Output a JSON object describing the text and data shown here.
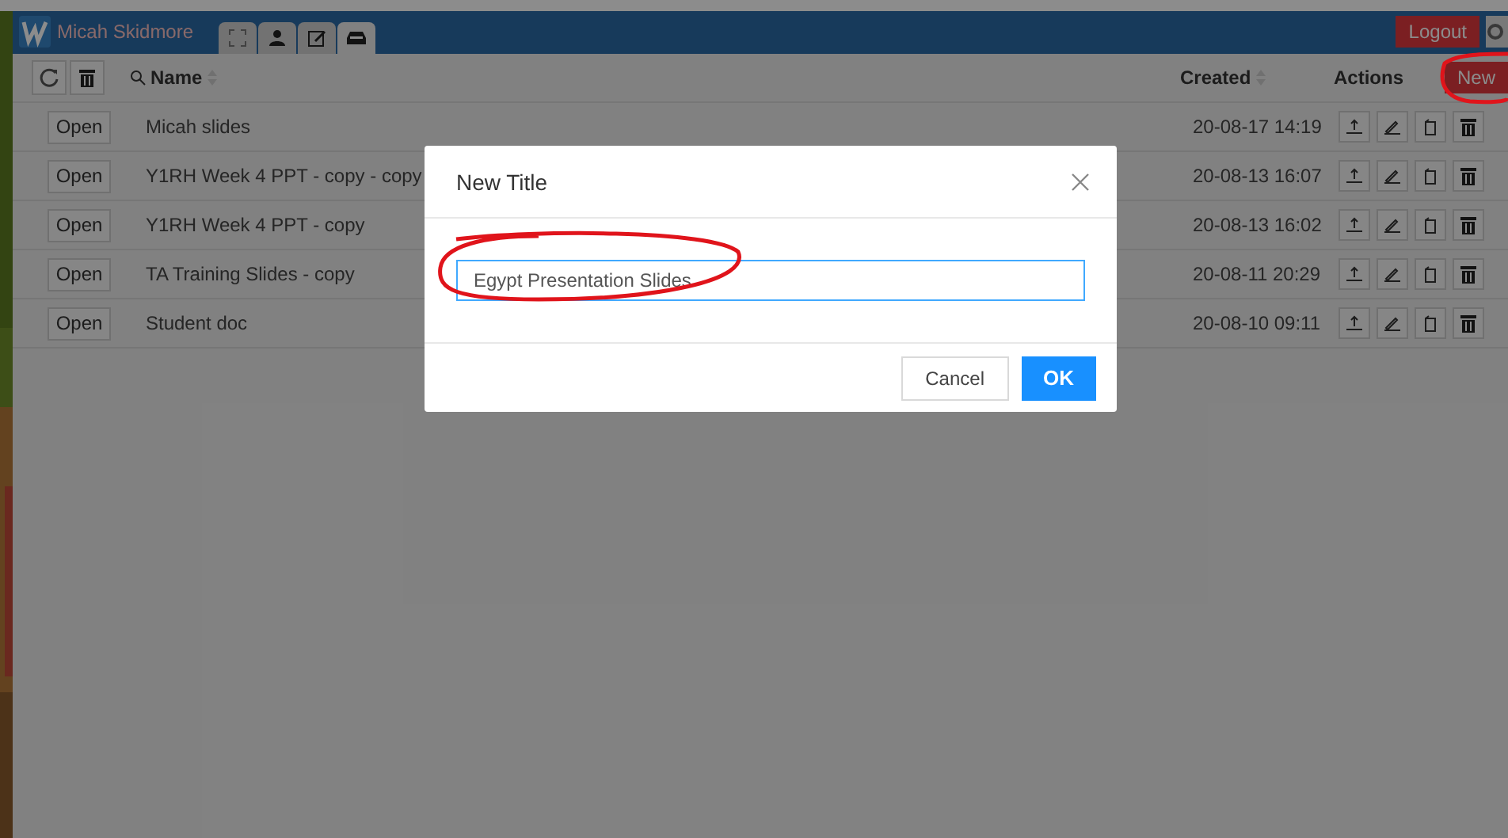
{
  "header": {
    "user": "Micah Skidmore",
    "tabs": [
      {
        "kind": "expand",
        "selected": false
      },
      {
        "kind": "person",
        "selected": false
      },
      {
        "kind": "edit",
        "selected": false
      },
      {
        "kind": "tray",
        "selected": true
      }
    ],
    "logout": "Logout"
  },
  "toolbar": {
    "name_column": "Name",
    "created_column": "Created",
    "actions_column": "Actions",
    "new_button": "New"
  },
  "rows": [
    {
      "open": "Open",
      "name": "Micah slides",
      "created": "20-08-17 14:19"
    },
    {
      "open": "Open",
      "name": "Y1RH Week 4 PPT - copy - copy",
      "created": "20-08-13 16:07"
    },
    {
      "open": "Open",
      "name": "Y1RH Week 4 PPT - copy",
      "created": "20-08-13 16:02"
    },
    {
      "open": "Open",
      "name": "TA Training Slides - copy",
      "created": "20-08-11 20:29"
    },
    {
      "open": "Open",
      "name": "Student doc",
      "created": "20-08-10 09:11"
    }
  ],
  "dialog": {
    "title": "New Title",
    "value": "Egypt Presentation Slides",
    "cancel": "Cancel",
    "ok": "OK"
  }
}
